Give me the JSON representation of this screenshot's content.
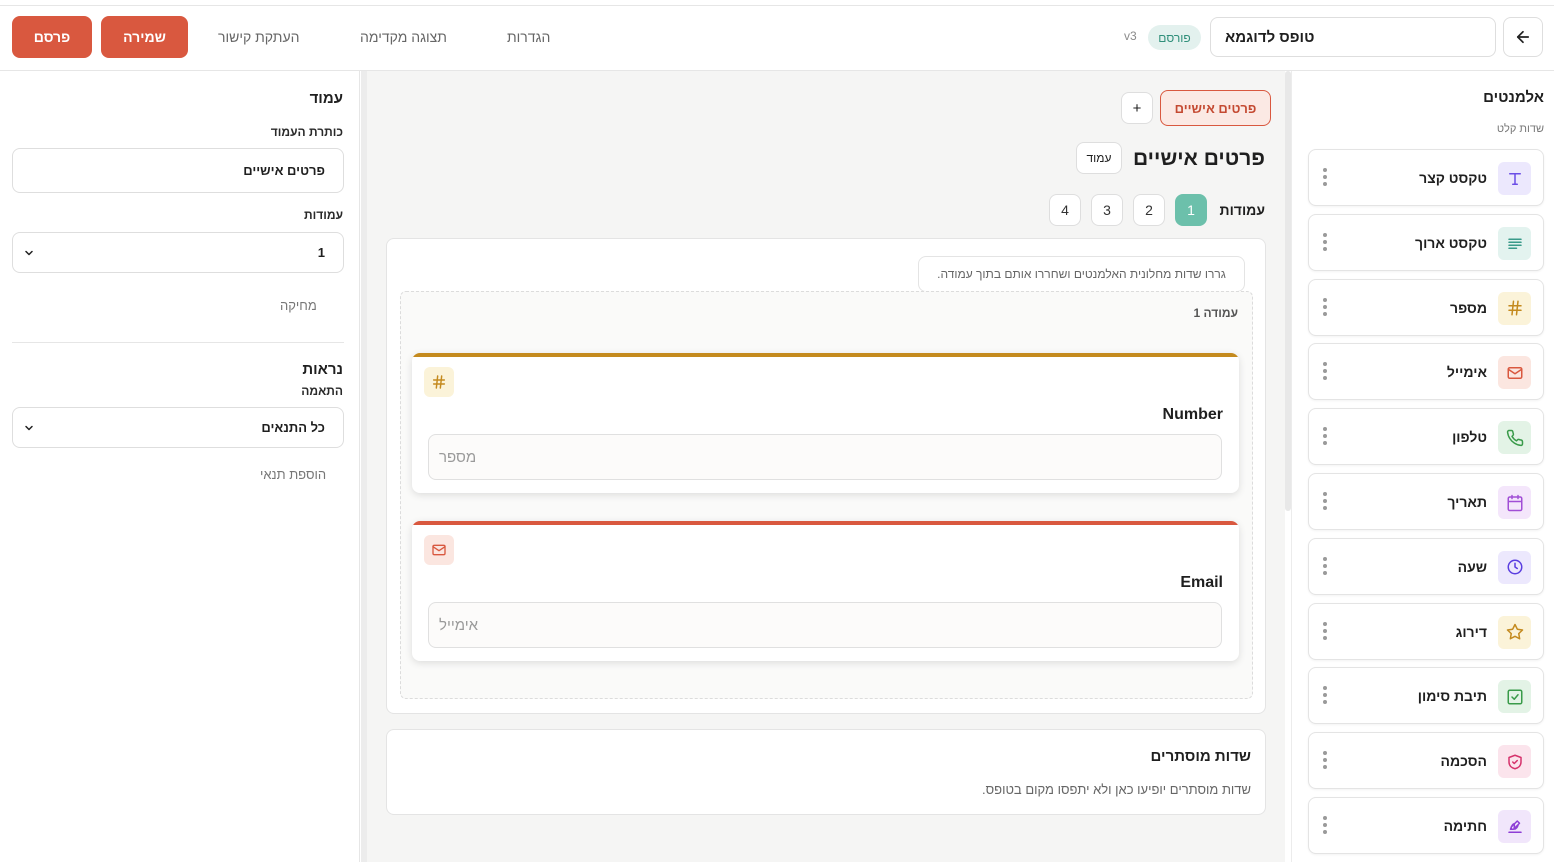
{
  "header": {
    "form_title": "טופס לדוגמא",
    "status": "פורסם",
    "version": "v3",
    "nav": {
      "settings": "הגדרות",
      "preview": "תצוגה מקדימה",
      "copy_link": "העתקת קישור"
    },
    "save_label": "שמירה",
    "publish_label": "פרסם"
  },
  "settings_panel": {
    "heading": "עמוד",
    "page_title_label": "כותרת העמוד",
    "page_title_value": "פרטים אישיים",
    "columns_label": "עמודות",
    "columns_value": "1",
    "delete_label": "מחיקה",
    "visibility_heading": "נראות",
    "match_label": "התאמה",
    "match_value": "כל התנאים",
    "add_condition_label": "הוספת תנאי"
  },
  "canvas": {
    "page_tab": "פרטים אישיים",
    "add_page": "+",
    "page_title": "פרטים אישיים",
    "page_type": "עמוד",
    "columns_label": "עמודות",
    "column_options": [
      "1",
      "2",
      "3",
      "4"
    ],
    "selected_column": "1",
    "hint": "גררו שדות מחלונית האלמנטים ושחררו אותם בתוך עמודה.",
    "column_name": "עמודה 1",
    "fields": [
      {
        "label": "Number",
        "placeholder": "מספר",
        "icon": "hash-icon",
        "accent": "#c48a1e"
      },
      {
        "label": "Email",
        "placeholder": "אימייל",
        "icon": "mail-icon",
        "accent": "#d9583f"
      }
    ],
    "hidden_fields_title": "שדות מוסתרים",
    "hidden_fields_desc": "שדות מוסתרים יופיעו כאן ולא יתפסו מקום בטופס."
  },
  "elements_panel": {
    "title": "אלמנטים",
    "subtitle": "שדות קלט",
    "items": [
      {
        "label": "טקסט קצר",
        "icon": "text-icon",
        "color": "#6b4ee6",
        "bg": "#ece8fd"
      },
      {
        "label": "טקסט ארוך",
        "icon": "paragraph-icon",
        "color": "#3a9b8a",
        "bg": "#e3f3ef"
      },
      {
        "label": "מספר",
        "icon": "hash-icon",
        "color": "#c48a1e",
        "bg": "#fbf3d9"
      },
      {
        "label": "אימייל",
        "icon": "mail-icon",
        "color": "#d9583f",
        "bg": "#fbe6e0"
      },
      {
        "label": "טלפון",
        "icon": "phone-icon",
        "color": "#3a9b4a",
        "bg": "#e3f3e6"
      },
      {
        "label": "תאריך",
        "icon": "calendar-icon",
        "color": "#a14ed6",
        "bg": "#f4e6fb"
      },
      {
        "label": "שעה",
        "icon": "clock-icon",
        "color": "#5a3ee0",
        "bg": "#ece8fd"
      },
      {
        "label": "דירוג",
        "icon": "star-icon",
        "color": "#c48a1e",
        "bg": "#fbf3d9"
      },
      {
        "label": "תיבת סימון",
        "icon": "checkbox-icon",
        "color": "#3a9b4a",
        "bg": "#e3f3e6"
      },
      {
        "label": "הסכמה",
        "icon": "shield-icon",
        "color": "#d6336c",
        "bg": "#fbe4ec"
      },
      {
        "label": "חתימה",
        "icon": "signature-icon",
        "color": "#8e3ed6",
        "bg": "#f1e6fb"
      }
    ]
  },
  "colors": {
    "brand_red": "#d9583f",
    "teal": "#6cc0ab"
  }
}
